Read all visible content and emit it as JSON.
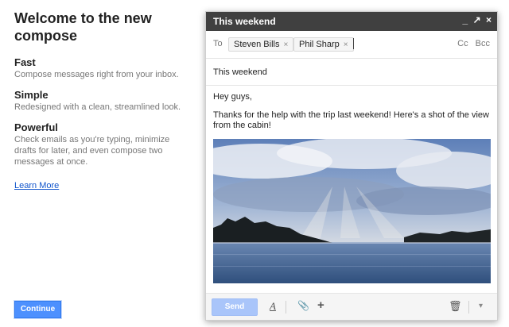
{
  "intro": {
    "title": "Welcome to the new compose",
    "features": [
      {
        "title": "Fast",
        "desc": "Compose messages right from your inbox."
      },
      {
        "title": "Simple",
        "desc": "Redesigned with a clean, streamlined look."
      },
      {
        "title": "Powerful",
        "desc": "Check emails as you're typing, minimize drafts for later, and even compose two messages at once."
      }
    ],
    "learn_more": "Learn More",
    "continue_label": "Continue"
  },
  "compose": {
    "window_title": "This weekend",
    "controls": {
      "minimize": "_",
      "popout": "↗",
      "close": "×"
    },
    "to_label": "To",
    "recipients": [
      "Steven Bills",
      "Phil Sharp"
    ],
    "remove_glyph": "×",
    "cc_label": "Cc",
    "bcc_label": "Bcc",
    "subject": "This weekend",
    "body_lines": [
      "Hey guys,",
      "Thanks for the help with the trip last weekend!  Here's a shot of the view from the cabin!"
    ],
    "toolbar": {
      "send_label": "Send",
      "format_glyph": "A",
      "attach_glyph": "📎",
      "insert_glyph": "+",
      "trash_glyph": "🗑",
      "more_glyph": "▾"
    }
  },
  "colors": {
    "accent": "#4d90fe",
    "titlebar": "#404040",
    "link": "#1155cc"
  }
}
